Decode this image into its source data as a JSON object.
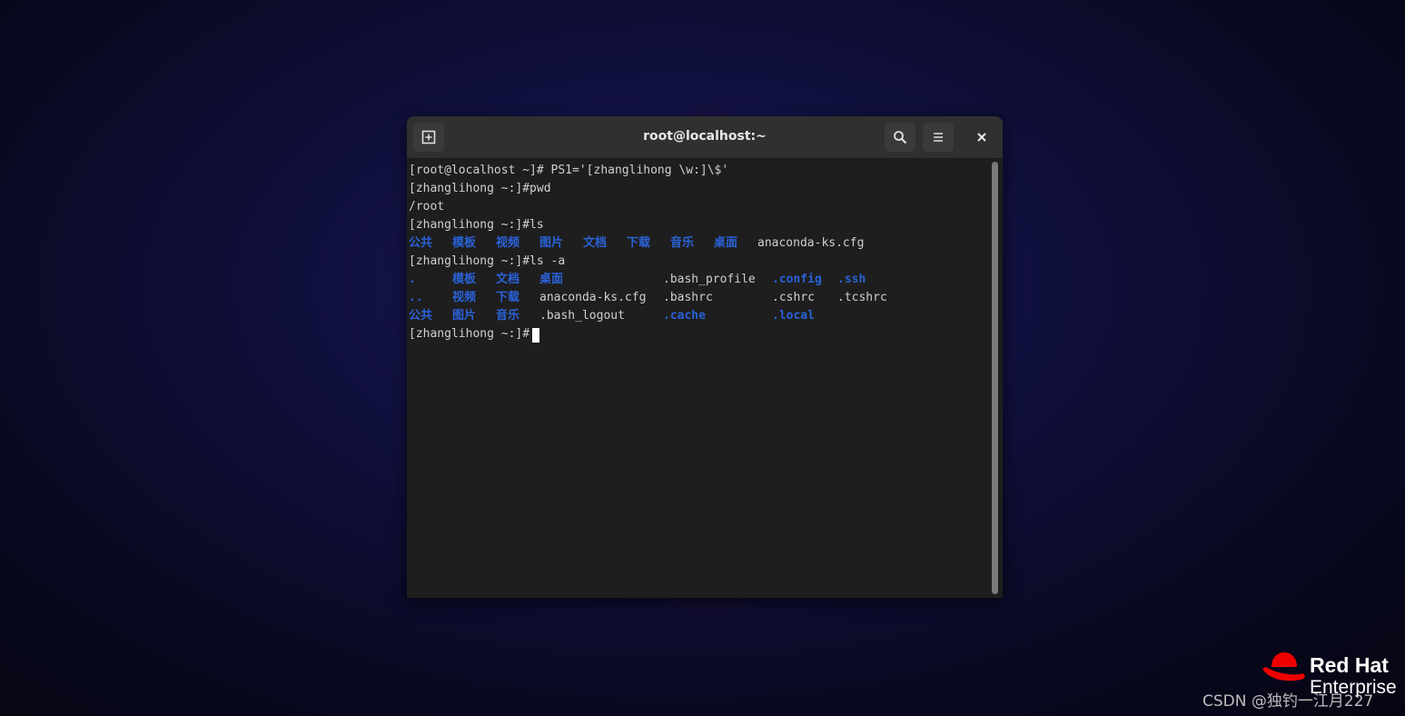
{
  "window": {
    "title": "root@localhost:~"
  },
  "terminal": {
    "lines": [
      "[root@localhost ~]# PS1='[zhanglihong \\w:]\\$'",
      "[zhanglihong ~:]#pwd",
      "/root",
      "[zhanglihong ~:]#ls",
      "[zhanglihong ~:]#ls -a",
      "[zhanglihong ~:]#"
    ],
    "ls_output": [
      "公共",
      "模板",
      "视频",
      "图片",
      "文档",
      "下载",
      "音乐",
      "桌面",
      "anaconda-ks.cfg"
    ],
    "ls_a_output": {
      "row1": [
        ".",
        "模板",
        "文档",
        "桌面",
        ".bash_profile",
        ".config",
        ".ssh"
      ],
      "row2": [
        "..",
        "视频",
        "下载",
        "anaconda-ks.cfg",
        ".bashrc",
        ".cshrc",
        ".tcshrc"
      ],
      "row3": [
        "公共",
        "图片",
        "音乐",
        ".bash_logout",
        ".cache",
        ".local"
      ]
    }
  },
  "branding": {
    "logo_name": "Red Hat",
    "logo_sub": "Enterprise"
  },
  "watermark": "CSDN @独钓一江月227",
  "colors": {
    "directory": "#2a62d8",
    "terminal_bg": "#1e1e1e",
    "titlebar_bg": "#303030",
    "redhat_red": "#ee0000"
  }
}
